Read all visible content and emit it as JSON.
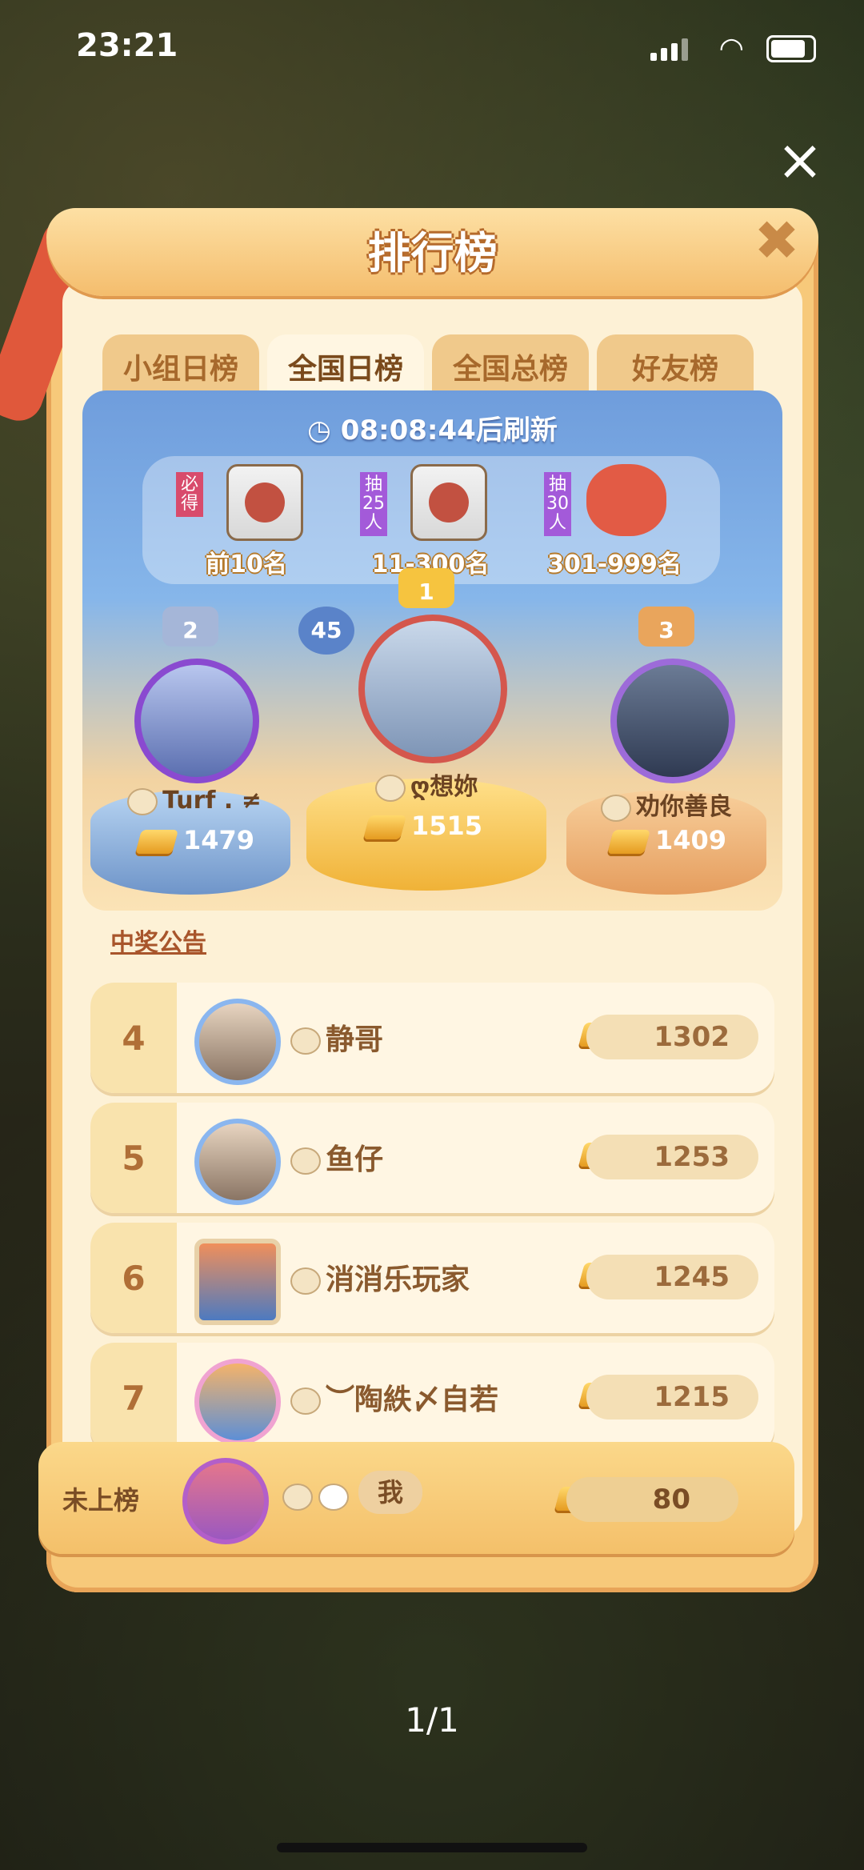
{
  "status": {
    "time": "23:21"
  },
  "header": {
    "title": "排行榜"
  },
  "tabs": [
    "小组日榜",
    "全国日榜",
    "全国总榜",
    "好友榜"
  ],
  "active_tab": 1,
  "refresh": "08:08:44后刷新",
  "prizes": [
    {
      "tag": "必得",
      "label": "前10名"
    },
    {
      "tag": "抽25人",
      "label": "11-300名"
    },
    {
      "tag": "抽30人",
      "label": "301-999名"
    }
  ],
  "podium": [
    {
      "rank": "2",
      "name": "Turf . ≠",
      "score": "1479"
    },
    {
      "rank": "1",
      "level": "45",
      "name": "ღ想妳",
      "score": "1515"
    },
    {
      "rank": "3",
      "name": "劝你善良",
      "score": "1409"
    }
  ],
  "notice": "中奖公告",
  "rows": [
    {
      "rank": "4",
      "name": "静哥",
      "score": "1302"
    },
    {
      "rank": "5",
      "name": "鱼仔",
      "score": "1253"
    },
    {
      "rank": "6",
      "name": "消消乐玩家",
      "score": "1245"
    },
    {
      "rank": "7",
      "name": "︶陶紩〆自若",
      "score": "1215"
    }
  ],
  "mine": {
    "label": "未上榜",
    "name": "我",
    "score": "80"
  },
  "page": "1/1",
  "colors": {
    "accent": "#f4bd6d",
    "panel": "#fdf1d6",
    "stage_sky": "#86b6ea"
  }
}
